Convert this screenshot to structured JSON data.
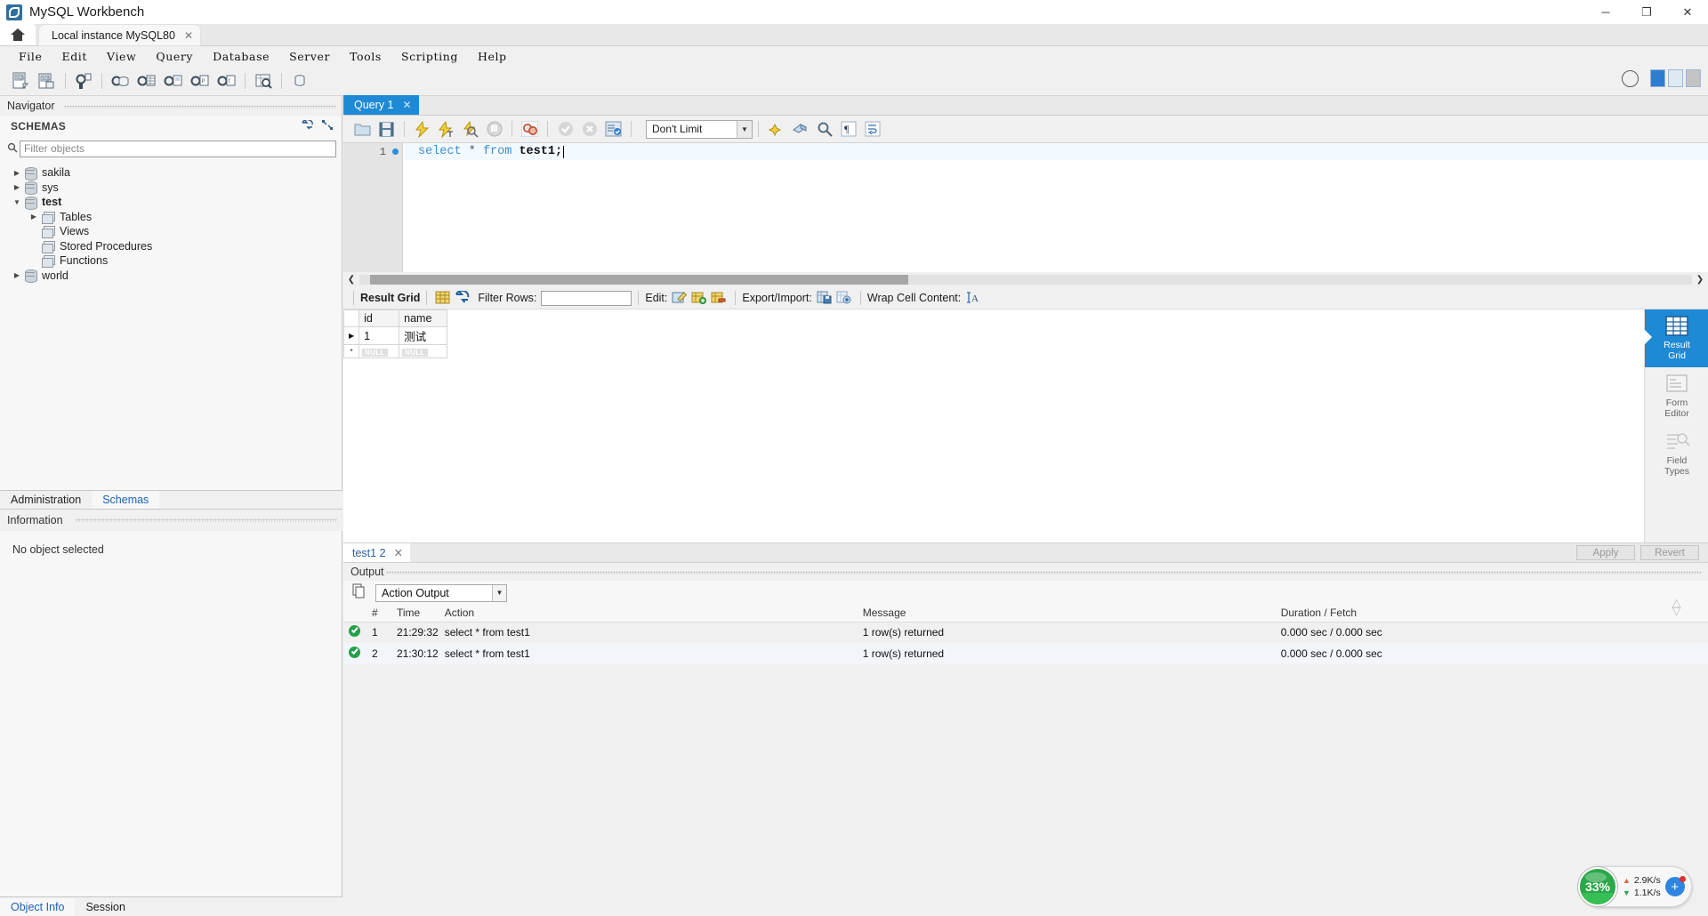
{
  "window": {
    "title": "MySQL Workbench",
    "minimize": "─",
    "maximize": "❐",
    "close": "✕"
  },
  "connection_tabs": {
    "home_icon": "home-icon",
    "active": "Local instance MySQL80",
    "close_glyph": "✕"
  },
  "menu": {
    "items": [
      "File",
      "Edit",
      "View",
      "Query",
      "Database",
      "Server",
      "Tools",
      "Scripting",
      "Help"
    ]
  },
  "main_toolbar": {
    "buttons": [
      "new-sql-tab-icon",
      "open-sql-script-icon",
      "new-connection-icon",
      "new-schema-icon",
      "new-table-icon",
      "new-view-icon",
      "new-procedure-icon",
      "new-function-icon",
      "search-data-icon",
      "reconnect-server-icon"
    ],
    "right": [
      "help-circle-icon",
      "toggle-sidebar-icon",
      "toggle-output-icon",
      "toggle-secondary-sidebar-icon"
    ]
  },
  "navigator": {
    "header": "Navigator",
    "schemas_label": "SCHEMAS",
    "header_icons": [
      "refresh-icon",
      "collapse-all-icon"
    ],
    "filter": {
      "placeholder": "Filter objects",
      "value": "",
      "icon": "search-icon"
    },
    "tree": [
      {
        "label": "sakila",
        "type": "schema",
        "expanded": false,
        "indent": 0,
        "bold": false
      },
      {
        "label": "sys",
        "type": "schema",
        "expanded": false,
        "indent": 0,
        "bold": false
      },
      {
        "label": "test",
        "type": "schema",
        "expanded": true,
        "indent": 0,
        "bold": true
      },
      {
        "label": "Tables",
        "type": "folder",
        "expanded": false,
        "indent": 1,
        "bold": false
      },
      {
        "label": "Views",
        "type": "folder",
        "expanded": null,
        "indent": 1,
        "bold": false
      },
      {
        "label": "Stored Procedures",
        "type": "folder",
        "expanded": null,
        "indent": 1,
        "bold": false
      },
      {
        "label": "Functions",
        "type": "folder",
        "expanded": null,
        "indent": 1,
        "bold": false
      },
      {
        "label": "world",
        "type": "schema",
        "expanded": false,
        "indent": 0,
        "bold": false
      }
    ],
    "bottom_tabs": [
      {
        "label": "Administration",
        "selected": false
      },
      {
        "label": "Schemas",
        "selected": true
      }
    ],
    "information_header": "Information",
    "information_body": "No object selected",
    "footer_tabs": [
      {
        "label": "Object Info",
        "selected": true
      },
      {
        "label": "Session",
        "selected": false
      }
    ]
  },
  "query": {
    "tab_label": "Query 1",
    "tab_close": "✕",
    "toolbar_buttons": [
      "open-script-icon",
      "save-script-icon",
      "execute-icon",
      "execute-current-statement-icon",
      "explain-icon",
      "stop-icon",
      "toggle-stop-on-error-icon",
      "commit-icon",
      "rollback-icon",
      "autocommit-icon"
    ],
    "toolbar_buttons_right": [
      "beautify-icon",
      "find-icon",
      "search-icon",
      "show-invisible-chars-icon",
      "wrap-lines-icon"
    ],
    "limit_selector": {
      "value": "Don't Limit"
    },
    "editor": {
      "line_number": "1",
      "sql_keyword_1": "select",
      "sql_star": "*",
      "sql_keyword_2": "from",
      "sql_table": "test1;"
    }
  },
  "result_toolbar": {
    "label": "Result Grid",
    "grid_icon": "grid-icon",
    "refresh_icon": "refresh-arrows-icon",
    "filter_label": "Filter Rows:",
    "filter_value": "",
    "edit_label": "Edit:",
    "edit_icons": [
      "edit-pencil-icon",
      "insert-row-icon",
      "delete-row-icon"
    ],
    "export_label": "Export/Import:",
    "export_icons": [
      "export-recordset-icon",
      "import-recordset-icon"
    ],
    "wrap_label": "Wrap Cell Content:",
    "wrap_icon": "wrap-text-icon"
  },
  "result_grid": {
    "columns": [
      "id",
      "name"
    ],
    "rows": [
      {
        "marker": "▶",
        "id": "1",
        "name": "测试"
      }
    ],
    "null_placeholder": "NULL",
    "new_row_marker": "*"
  },
  "side_panel": {
    "items": [
      {
        "label_line1": "Result",
        "label_line2": "Grid",
        "icon": "result-grid-icon",
        "selected": true
      },
      {
        "label_line1": "Form",
        "label_line2": "Editor",
        "icon": "form-editor-icon",
        "selected": false
      },
      {
        "label_line1": "Field",
        "label_line2": "Types",
        "icon": "field-types-icon",
        "selected": false
      }
    ],
    "chevrons": "◇"
  },
  "result_footer": {
    "tab_label": "test1 2",
    "tab_close": "✕",
    "apply_label": "Apply",
    "revert_label": "Revert"
  },
  "output": {
    "header": "Output",
    "toolbar_icon": "copy-icon",
    "selector_value": "Action Output",
    "columns": [
      "#",
      "Time",
      "Action",
      "Message",
      "Duration / Fetch"
    ],
    "rows": [
      {
        "status": "ok",
        "num": "1",
        "time": "21:29:32",
        "action": "select * from test1",
        "message": "1 row(s) returned",
        "duration": "0.000 sec / 0.000 sec"
      },
      {
        "status": "ok",
        "num": "2",
        "time": "21:30:12",
        "action": "select * from test1",
        "message": "1 row(s) returned",
        "duration": "0.000 sec / 0.000 sec"
      }
    ]
  },
  "net_widget": {
    "percent": "33%",
    "upload": "2.9K/s",
    "download": "1.1K/s",
    "up_arrow": "▲",
    "down_arrow": "▼",
    "plus": "+"
  },
  "colors": {
    "accent": "#1e8ad6",
    "ok": "#24a148",
    "keyword": "#3d8fd0"
  }
}
